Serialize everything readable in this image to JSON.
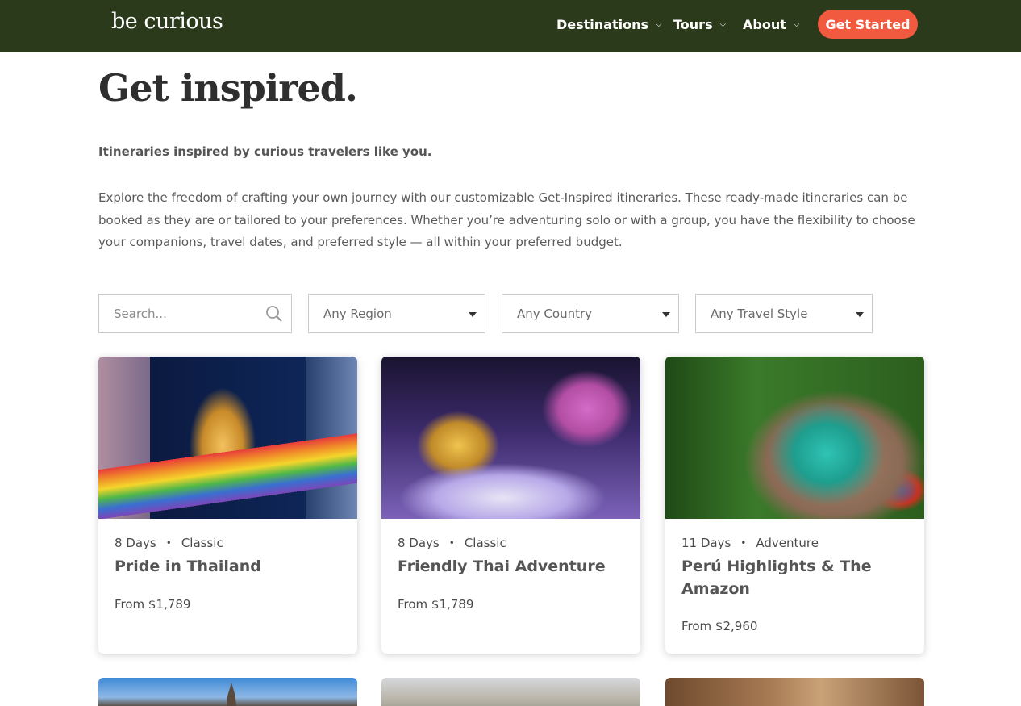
{
  "header": {
    "logo_text": "be curious",
    "nav": [
      {
        "label": "Destinations"
      },
      {
        "label": "Tours"
      },
      {
        "label": "About"
      }
    ],
    "cta_label": "Get Started",
    "colors": {
      "bar": "#2c3a1c",
      "accent": "#f15a3f"
    }
  },
  "intro": {
    "title": "Get inspired.",
    "subtitle": "Itineraries inspired by curious travelers like you.",
    "body": "Explore the freedom of crafting your own journey with our customizable Get-Inspired itineraries. These ready-made itineraries can be booked as they are or tailored to your preferences. Whether you’re adventuring solo or with a group, you have the flexibility to choose your companions, travel dates, and preferred style — all within your preferred budget."
  },
  "filters": {
    "search": {
      "placeholder": "Search...",
      "value": ""
    },
    "region": "Any Region",
    "country": "Any Country",
    "travel_style": "Any Travel Style"
  },
  "cards": [
    {
      "duration": "8 Days",
      "style": "Classic",
      "name": "Pride in Thailand",
      "price": "From $1,789"
    },
    {
      "duration": "8 Days",
      "style": "Classic",
      "name": "Friendly Thai Adventure",
      "price": "From $1,789"
    },
    {
      "duration": "11 Days",
      "style": "Adventure",
      "name": "Perú Highlights & The Amazon",
      "price": "From $2,960"
    }
  ],
  "icons": {
    "search": "search-icon",
    "dropdown": "chevron-down-icon",
    "caret": "caret-down-icon"
  }
}
